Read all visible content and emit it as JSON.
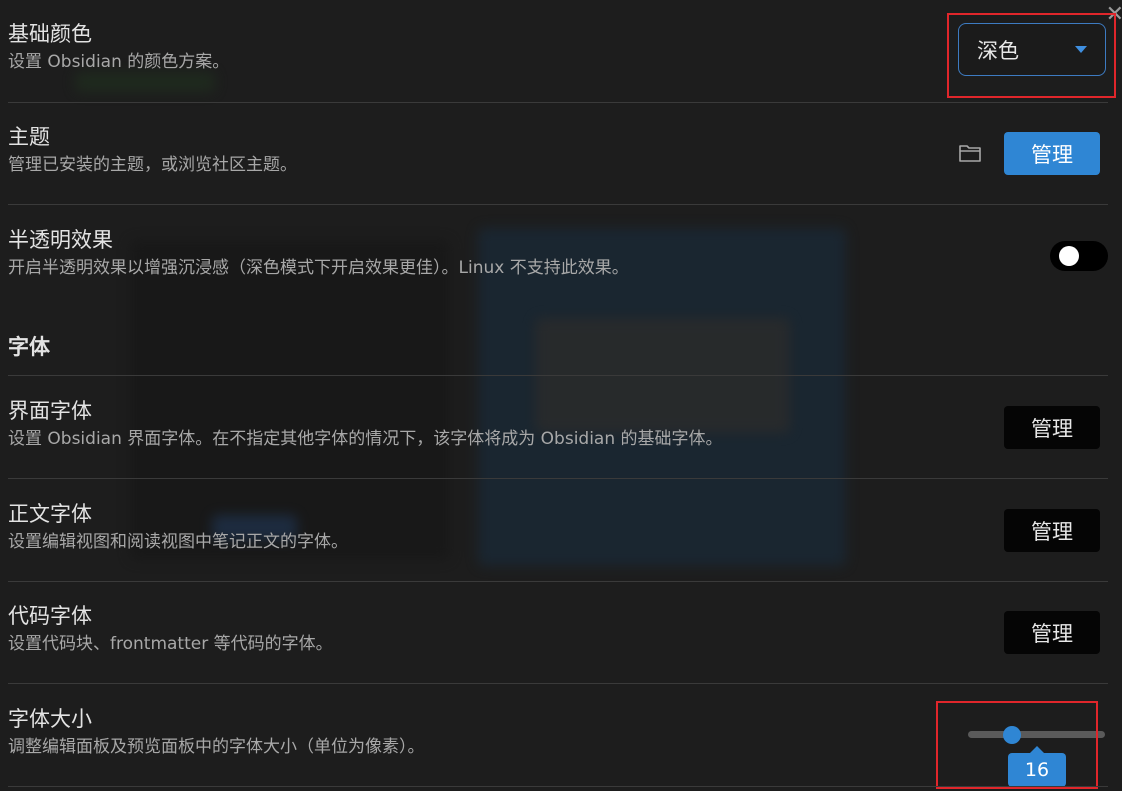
{
  "settings": {
    "base_color": {
      "name": "基础颜色",
      "desc": "设置 Obsidian 的颜色方案。",
      "selected": "深色"
    },
    "theme": {
      "name": "主题",
      "desc": "管理已安装的主题，或浏览社区主题。",
      "button": "管理",
      "folder_icon": "folder-icon"
    },
    "translucent": {
      "name": "半透明效果",
      "desc": "开启半透明效果以增强沉浸感（深色模式下开启效果更佳）。Linux 不支持此效果。",
      "enabled": false
    },
    "font_section": "字体",
    "ui_font": {
      "name": "界面字体",
      "desc": "设置 Obsidian 界面字体。在不指定其他字体的情况下，该字体将成为 Obsidian 的基础字体。",
      "button": "管理"
    },
    "text_font": {
      "name": "正文字体",
      "desc": "设置编辑视图和阅读视图中笔记正文的字体。",
      "button": "管理"
    },
    "code_font": {
      "name": "代码字体",
      "desc": "设置代码块、frontmatter 等代码的字体。",
      "button": "管理"
    },
    "font_size": {
      "name": "字体大小",
      "desc": "调整编辑面板及预览面板中的字体大小（单位为像素）。",
      "value": "16"
    }
  },
  "colors": {
    "accent": "#2f86d4",
    "highlight": "#e0262b",
    "background": "#1d1d1d"
  }
}
